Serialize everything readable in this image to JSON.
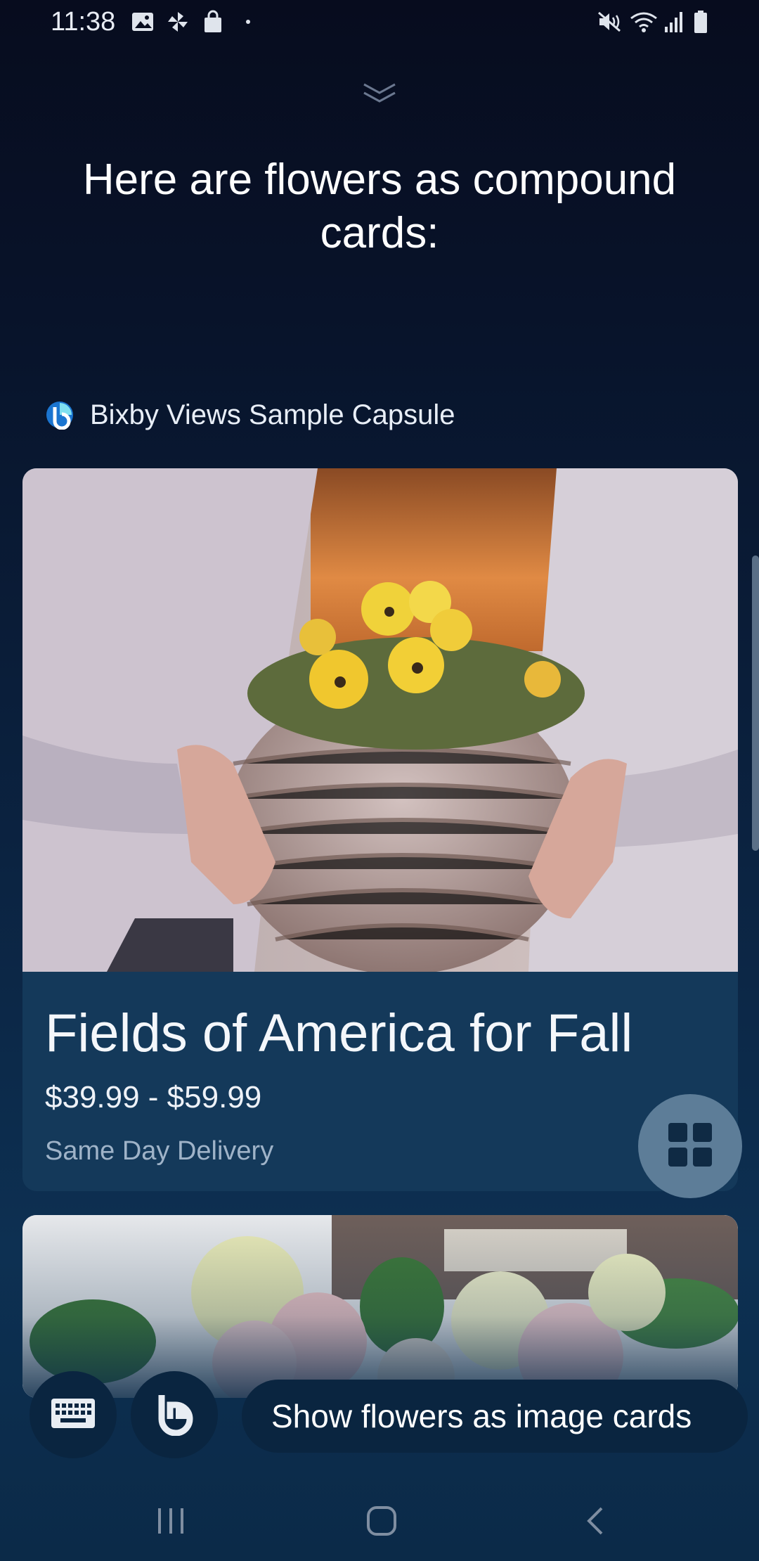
{
  "status_bar": {
    "time": "11:38",
    "left_icons": [
      "gallery-icon",
      "pinwheel-icon",
      "shopping-bag-icon",
      "dot-icon"
    ],
    "right_icons": [
      "mute-icon",
      "wifi-icon",
      "signal-icon",
      "battery-icon"
    ]
  },
  "headline": "Here are flowers as compound cards:",
  "capsule": {
    "name": "Bixby Views Sample Capsule",
    "logo": "bixby-logo-icon"
  },
  "cards": [
    {
      "title": "Fields of America for Fall",
      "price": "$39.99 - $59.99",
      "delivery": "Same Day Delivery",
      "image": "yellow pansies in woven basket held by hands"
    },
    {
      "image": "pink and cream roses"
    }
  ],
  "view_toggle_icon": "grid-view-icon",
  "bottom_bar": {
    "keyboard_icon": "keyboard-icon",
    "bixby_icon": "bixby-icon",
    "suggestion": "Show flowers as image cards"
  },
  "nav": [
    "recent-apps-icon",
    "home-icon",
    "back-icon"
  ],
  "colors": {
    "background_top": "#070c1e",
    "background_bottom": "#0b2a48",
    "card": "#14395a",
    "chip": "#0a2540",
    "toggle": "#5d7d98",
    "muted_text": "#9fb3c8"
  }
}
